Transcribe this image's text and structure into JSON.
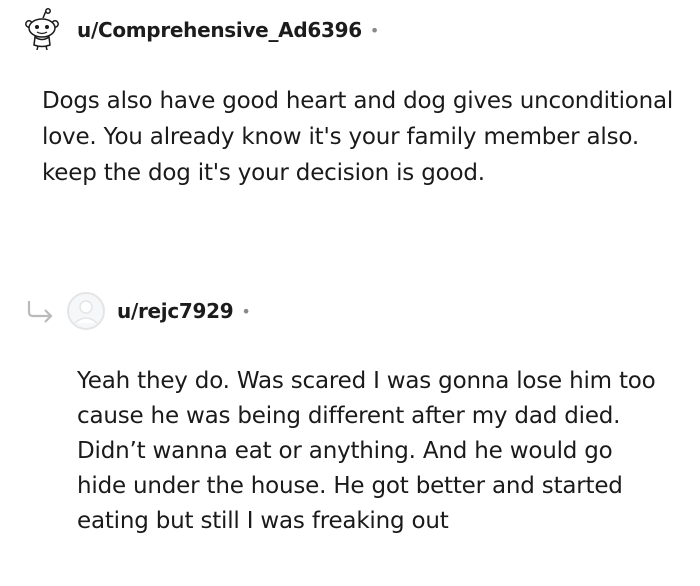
{
  "comment": {
    "username": "u/Comprehensive_Ad6396",
    "separator": "•",
    "text": "Dogs also have good heart and dog gives unconditional love. You already know it's your family member also. keep the dog it's your decision is good."
  },
  "reply": {
    "username": "u/rejc7929",
    "separator": "•",
    "text": "Yeah they do. Was scared I was gonna lose him too cause he was being different after my dad died. Didn’t wanna eat or anything. And he would go hide under the house. He got better and started eating but still I was freaking out"
  },
  "icons": {
    "comment_avatar": "snoo-avatar-icon",
    "reply_avatar": "default-avatar-icon",
    "reply_indicator": "reply-arrow-icon"
  }
}
